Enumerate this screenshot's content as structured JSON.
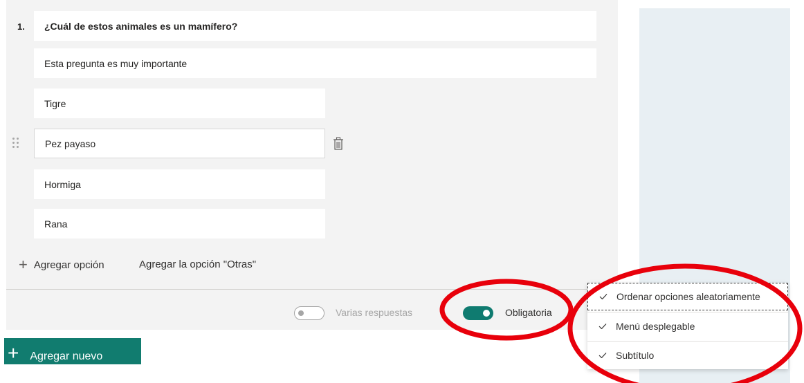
{
  "question": {
    "number": "1.",
    "title": "¿Cuál de estos animales es un mamífero?",
    "subtitle": "Esta pregunta es muy importante"
  },
  "options": [
    "Tigre",
    "Pez payaso",
    "Hormiga",
    "Rana"
  ],
  "actions": {
    "add_option": "Agregar opción",
    "add_other": "Agregar la opción \"Otras\""
  },
  "footer": {
    "multiple_answers": {
      "label": "Varias respuestas",
      "enabled": false
    },
    "required": {
      "label": "Obligatoria",
      "enabled": true
    }
  },
  "add_new": "Agregar nuevo",
  "menu": {
    "items": [
      {
        "label": "Ordenar opciones aleatoriamente",
        "checked": true
      },
      {
        "label": "Menú desplegable",
        "checked": true
      },
      {
        "label": "Subtítulo",
        "checked": true
      }
    ]
  },
  "colors": {
    "accent": "#117c6f",
    "annotation": "#e8000b",
    "right_rail": "#e8eff3",
    "panel": "#f3f3f3"
  },
  "icons": [
    "drag-handle-icon",
    "trash-icon",
    "plus-icon",
    "check-icon"
  ]
}
